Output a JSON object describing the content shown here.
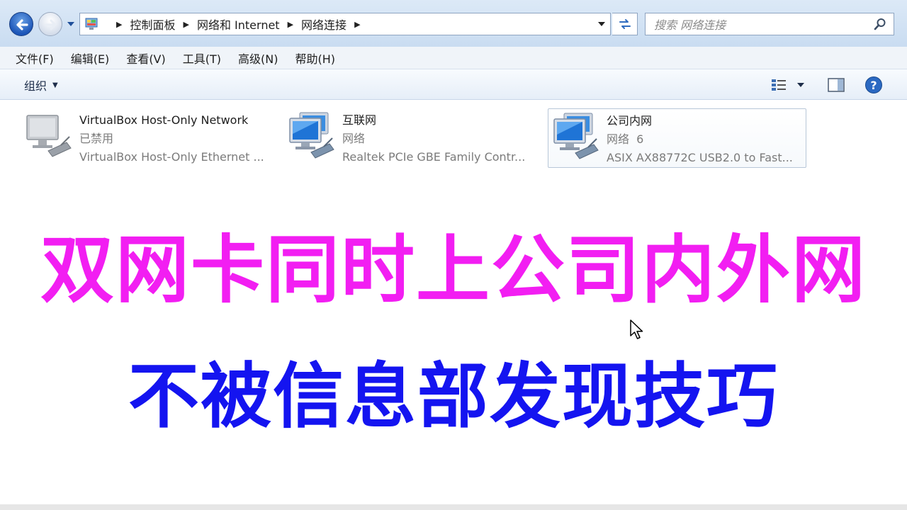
{
  "address": {
    "crumbs": [
      "控制面板",
      "网络和 Internet",
      "网络连接"
    ],
    "search_placeholder": "搜索 网络连接"
  },
  "menu": {
    "items": [
      "文件(F)",
      "编辑(E)",
      "查看(V)",
      "工具(T)",
      "高级(N)",
      "帮助(H)"
    ]
  },
  "commandbar": {
    "organize_label": "组织"
  },
  "connections": [
    {
      "name": "VirtualBox Host-Only Network",
      "status": "已禁用",
      "device": "VirtualBox Host-Only Ethernet ..."
    },
    {
      "name": "互联网",
      "status": "网络",
      "device": "Realtek PCIe GBE Family Contr..."
    },
    {
      "name": "公司内网",
      "status": "网络  6",
      "device": "ASIX AX88772C USB2.0 to Fast..."
    }
  ],
  "overlay": {
    "line1": "双网卡同时上公司内外网",
    "line2": "不被信息部发现技巧",
    "line1_color": "#f21ef2",
    "line2_color": "#1414f0"
  },
  "icons": {
    "back": "back-arrow-icon",
    "forward": "forward-arrow-icon",
    "network": "network-adapter-icon",
    "search": "search-icon",
    "help": "help-icon"
  }
}
